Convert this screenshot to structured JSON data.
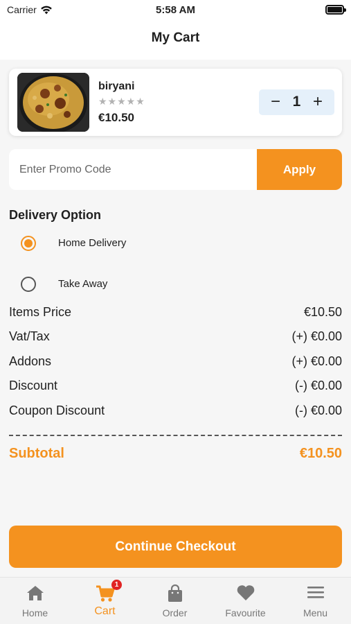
{
  "status_bar": {
    "carrier": "Carrier",
    "time": "5:58 AM"
  },
  "nav": {
    "title": "My Cart"
  },
  "cart_item": {
    "name": "biryani",
    "rating": "★★★★★",
    "price": "€10.50",
    "quantity": "1",
    "minus": "−",
    "plus": "+"
  },
  "promo": {
    "placeholder": "Enter Promo Code",
    "apply_label": "Apply"
  },
  "delivery": {
    "title": "Delivery Option",
    "options": [
      {
        "label": "Home Delivery",
        "selected": true
      },
      {
        "label": "Take Away",
        "selected": false
      }
    ]
  },
  "summary": {
    "rows": [
      {
        "label": "Items Price",
        "value": "€10.50"
      },
      {
        "label": "Vat/Tax",
        "value": "(+) €0.00"
      },
      {
        "label": "Addons",
        "value": "(+) €0.00"
      },
      {
        "label": "Discount",
        "value": "(-) €0.00"
      },
      {
        "label": "Coupon Discount",
        "value": "(-) €0.00"
      }
    ],
    "subtotal_label": "Subtotal",
    "subtotal_value": "€10.50"
  },
  "checkout": {
    "label": "Continue Checkout"
  },
  "tab_bar": {
    "active": "Cart",
    "cart_badge": "1",
    "tabs": [
      {
        "label": "Home",
        "icon": "home-icon"
      },
      {
        "label": "Cart",
        "icon": "cart-icon"
      },
      {
        "label": "Order",
        "icon": "shopping-bag-icon"
      },
      {
        "label": "Favourite",
        "icon": "heart-icon"
      },
      {
        "label": "Menu",
        "icon": "menu-icon"
      }
    ]
  },
  "colors": {
    "accent": "#f4921f",
    "badge": "#e02424",
    "qty_bg": "#e5f0fa"
  }
}
